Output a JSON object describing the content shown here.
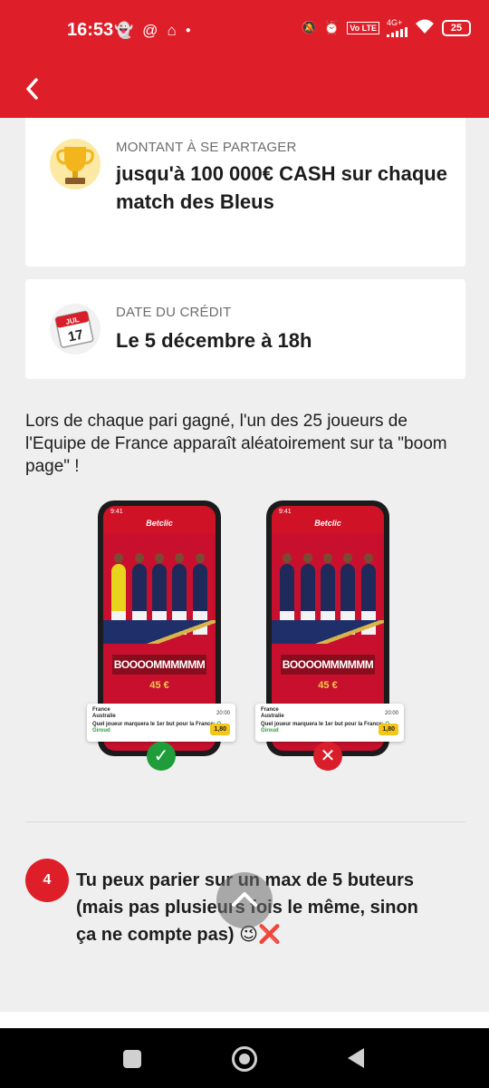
{
  "status_bar": {
    "time": "16:53",
    "network_label": "4G+",
    "lte_label": "Vo LTE",
    "battery": "25",
    "left_icons": [
      "snapchat-icon",
      "threads-icon",
      "airbnb-icon",
      "dot-icon"
    ],
    "right_icons": [
      "mute-icon",
      "alarm-icon",
      "signal-icon",
      "wifi-icon",
      "battery-icon"
    ]
  },
  "header": {
    "back_icon": "chevron-left-icon",
    "background": "#de1e28"
  },
  "prize_card": {
    "label": "MONTANT À SE PARTAGER",
    "value": "jusqu'à 100 000€ CASH sur chaque match des Bleus",
    "icon": "trophy-icon"
  },
  "date_card": {
    "label": "DATE DU CRÉDIT",
    "value": "Le 5 décembre à 18h",
    "icon": "calendar-icon",
    "icon_month": "JUL",
    "icon_day": "17"
  },
  "description": "Lors de chaque pari gagné, l'un des 25 joueurs de l'Equipe de France apparaît aléatoirement sur ta \"boom page\" !",
  "illustration": {
    "phones": [
      {
        "status_time": "9:41",
        "brand": "Betclic",
        "boom_text": "BOOOOMMMMMM",
        "amount": "45 €",
        "bet": {
          "team1": "France",
          "team2": "Australie",
          "time": "20:00",
          "question": "Quel joueur marquera le 1er but pour la France:",
          "player": "O. Giroud",
          "odd": "1,80"
        },
        "result": "✓",
        "result_color": "#1f9d3a"
      },
      {
        "status_time": "9:41",
        "brand": "Betclic",
        "boom_text": "BOOOOMMMMMM",
        "amount": "45 €",
        "bet": {
          "team1": "France",
          "team2": "Australie",
          "time": "20:00",
          "question": "Quel joueur marquera le 1er but pour la France:",
          "player": "O. Giroud",
          "odd": "1,80"
        },
        "result": "✕",
        "result_color": "#d81e2a"
      }
    ]
  },
  "step": {
    "number": "4",
    "text": "Tu peux parier sur un max de 5 buteurs (mais pas plusieurs fois le même, sinon ça ne compte pas)",
    "emojis": "😉",
    "cross": "❌"
  },
  "scroll_up_icon": "chevron-up-icon",
  "nav_bar": {
    "icons": [
      "recent-apps-icon",
      "home-icon",
      "back-triangle-icon"
    ]
  }
}
